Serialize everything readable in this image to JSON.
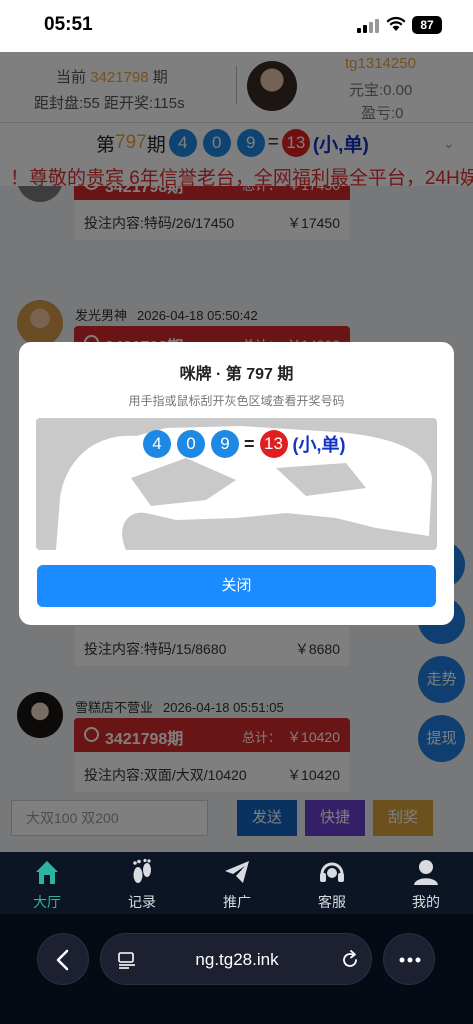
{
  "status": {
    "time": "05:51",
    "battery": "87"
  },
  "header": {
    "current_label": "当前",
    "current_period": "3421798",
    "period_suffix": "期",
    "timer": "距封盘:55 距开奖:115s",
    "username": "tg1314250",
    "yuanbao": "元宝:0.00",
    "yingkui": "盈亏:0"
  },
  "period_bar": {
    "prefix": "第",
    "period_num": "797",
    "suffix": "期",
    "balls": [
      "4",
      "0",
      "9"
    ],
    "equals": "=",
    "sum": "13",
    "result": "(小,单)"
  },
  "marquee": "！尊敬的贵宾 6年信誉老台，全网福利最全平台，24H娱",
  "feed": [
    {
      "name": "",
      "time": "",
      "period": "3421798期",
      "total_label": "总计：",
      "total": "￥17450",
      "content": "投注内容:特码/26/17450",
      "amount": "￥17450"
    },
    {
      "name": "发光男神",
      "time": "2026-04-18 05:50:42",
      "period": "3421798期",
      "total_label": "总计：",
      "total": "￥14000",
      "content": "",
      "amount": ""
    },
    {
      "name": "",
      "time": "",
      "period": "",
      "total_label": "",
      "total": "",
      "content": "投注内容:特码/15/8680",
      "amount": "￥8680"
    },
    {
      "name": "雪糕店不营业",
      "time": "2026-04-18 05:51:05",
      "period": "3421798期",
      "total_label": "总计：",
      "total": "￥10420",
      "content": "投注内容:双面/大双/10420",
      "amount": "￥10420"
    }
  ],
  "side_buttons": [
    "走势",
    "提现"
  ],
  "modal": {
    "title": "咪牌 · 第 797 期",
    "subtitle": "用手指或鼠标刮开灰色区域查看开奖号码",
    "balls": [
      "4",
      "0",
      "9"
    ],
    "equals": "=",
    "sum": "13",
    "result": "(小,单)",
    "close_label": "关闭"
  },
  "input": {
    "placeholder": "大双100 双200"
  },
  "actions": {
    "send": "发送",
    "quick": "快捷",
    "scratch": "刮奖"
  },
  "colors": {
    "send": "#1565c0",
    "quick": "#6a3fd0",
    "scratch": "#d9a13a",
    "accent": "#1a8cff",
    "card_header": "#d52b2b"
  },
  "tabs": [
    {
      "label": "大厅",
      "icon": "home-icon",
      "active": true
    },
    {
      "label": "记录",
      "icon": "footprint-icon",
      "active": false
    },
    {
      "label": "推广",
      "icon": "send-icon",
      "active": false
    },
    {
      "label": "客服",
      "icon": "headset-icon",
      "active": false
    },
    {
      "label": "我的",
      "icon": "user-icon",
      "active": false
    }
  ],
  "browser": {
    "url": "ng.tg28.ink"
  }
}
